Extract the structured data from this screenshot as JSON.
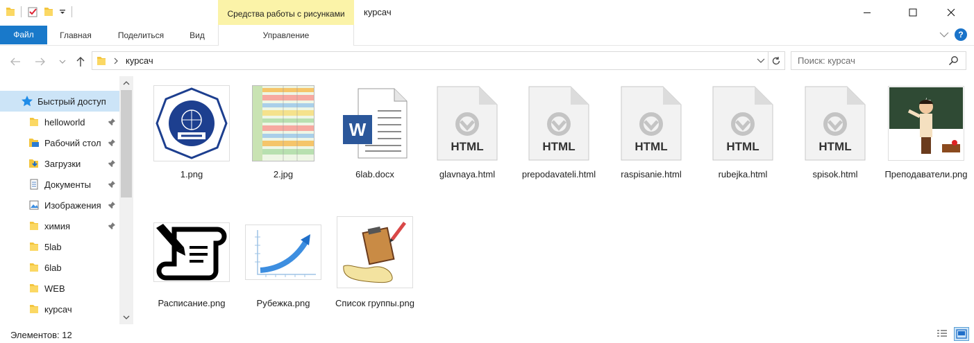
{
  "window": {
    "title": "курсач",
    "context_tools_label": "Средства работы с рисунками"
  },
  "ribbon": {
    "tabs": [
      "Файл",
      "Главная",
      "Поделиться",
      "Вид",
      "Управление"
    ]
  },
  "address": {
    "path": "курсач",
    "search_placeholder": "Поиск: курсач"
  },
  "sidebar": {
    "items": [
      {
        "label": "Быстрый доступ",
        "icon": "star-icon",
        "pinned": false
      },
      {
        "label": "helloworld",
        "icon": "folder-icon",
        "pinned": true
      },
      {
        "label": "Рабочий стол",
        "icon": "desktop-folder-icon",
        "pinned": true
      },
      {
        "label": "Загрузки",
        "icon": "downloads-folder-icon",
        "pinned": true
      },
      {
        "label": "Документы",
        "icon": "documents-folder-icon",
        "pinned": true
      },
      {
        "label": "Изображения",
        "icon": "pictures-folder-icon",
        "pinned": true
      },
      {
        "label": "химия",
        "icon": "folder-icon",
        "pinned": true
      },
      {
        "label": "5lab",
        "icon": "folder-icon",
        "pinned": false
      },
      {
        "label": "6lab",
        "icon": "folder-icon",
        "pinned": false
      },
      {
        "label": "WEB",
        "icon": "folder-icon",
        "pinned": false
      },
      {
        "label": "курсач",
        "icon": "folder-icon",
        "pinned": false
      }
    ]
  },
  "files": [
    {
      "name": "1.png",
      "kind": "mtuci-logo"
    },
    {
      "name": "2.jpg",
      "kind": "schedule-table"
    },
    {
      "name": "6lab.docx",
      "kind": "word"
    },
    {
      "name": "glavnaya.html",
      "kind": "html",
      "badge": "HTML"
    },
    {
      "name": "prepodavateli.html",
      "kind": "html",
      "badge": "HTML"
    },
    {
      "name": "raspisanie.html",
      "kind": "html",
      "badge": "HTML"
    },
    {
      "name": "rubejka.html",
      "kind": "html",
      "badge": "HTML"
    },
    {
      "name": "spisok.html",
      "kind": "html",
      "badge": "HTML"
    },
    {
      "name": "Преподаватели.png",
      "kind": "teacher"
    },
    {
      "name": "Расписание.png",
      "kind": "scroll"
    },
    {
      "name": "Рубежка.png",
      "kind": "chart-arrow"
    },
    {
      "name": "Список группы.png",
      "kind": "clipboard"
    }
  ],
  "status": {
    "count_text": "Элементов: 12"
  },
  "colors": {
    "accent": "#1979ca",
    "tools_band": "#fbf3a8",
    "selection": "#cce4f7"
  }
}
